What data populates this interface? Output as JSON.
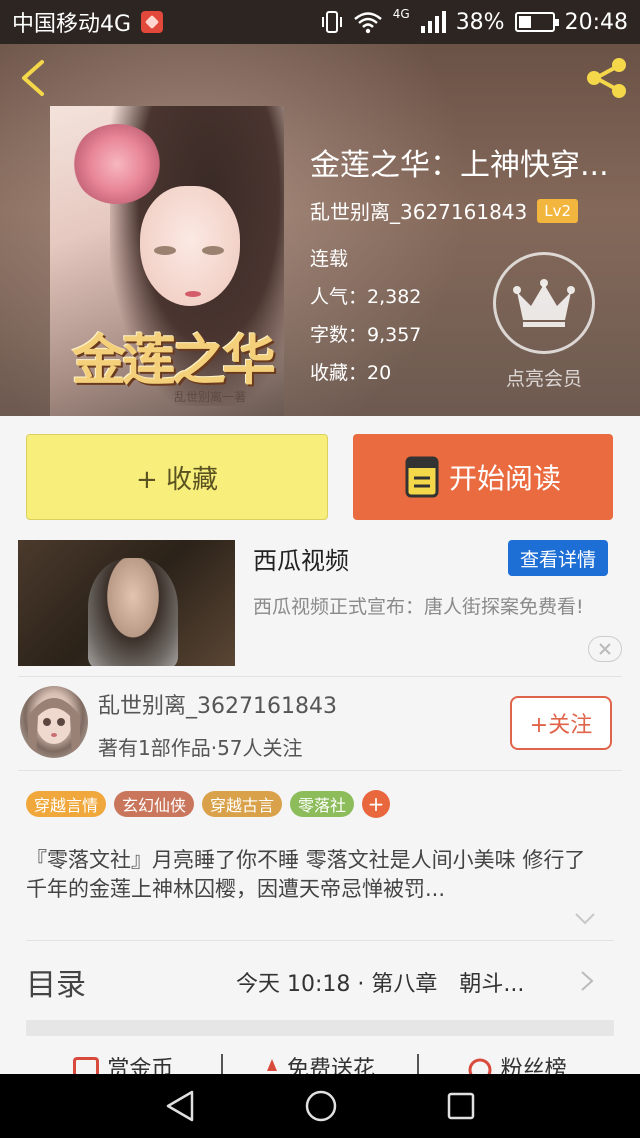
{
  "status_bar": {
    "carrier": "中国移动4G",
    "network": "4G",
    "battery_percent": "38%",
    "battery_level": 0.38,
    "time": "20:48"
  },
  "book": {
    "title": "金莲之华：上神快穿...",
    "cover_title": "金莲之华",
    "cover_author": "乱世别离一著",
    "author": "乱世别离_3627161843",
    "author_level": "Lv2",
    "status": "连载",
    "popularity": "人气：2,382",
    "word_count": "字数：9,357",
    "favorites": "收藏：20",
    "vip_label": "点亮会员"
  },
  "actions": {
    "collect": "+ 收藏",
    "read": "开始阅读"
  },
  "ad": {
    "title": "西瓜视频",
    "detail_button": "查看详情",
    "description": "西瓜视频正式宣布：唐人街探案免费看!"
  },
  "writer": {
    "name": "乱世别离_3627161843",
    "stats": "著有1部作品·57人关注",
    "follow_button": "+关注"
  },
  "tags": [
    {
      "label": "穿越言情",
      "color": "#f0a83c"
    },
    {
      "label": "玄幻仙侠",
      "color": "#c9765c"
    },
    {
      "label": "穿越古言",
      "color": "#d9a24a"
    },
    {
      "label": "零落社",
      "color": "#8cbd5a"
    }
  ],
  "synopsis": "『零落文社』月亮睡了你不睡 零落文社是人间小美味 修行了千年的金莲上神林囚樱，因遭天帝忌惮被罚...",
  "toc": {
    "label": "目录",
    "latest": "今天 10:18 · 第八章　朝斗..."
  },
  "bottom_actions": [
    {
      "label": "赏金币"
    },
    {
      "label": "免费送花"
    },
    {
      "label": "粉丝榜"
    }
  ],
  "colors": {
    "accent": "#ea6b3f",
    "collect_bg": "#f8ee7c",
    "ad_button": "#1d6fd6",
    "level_badge": "#f2b53d"
  }
}
